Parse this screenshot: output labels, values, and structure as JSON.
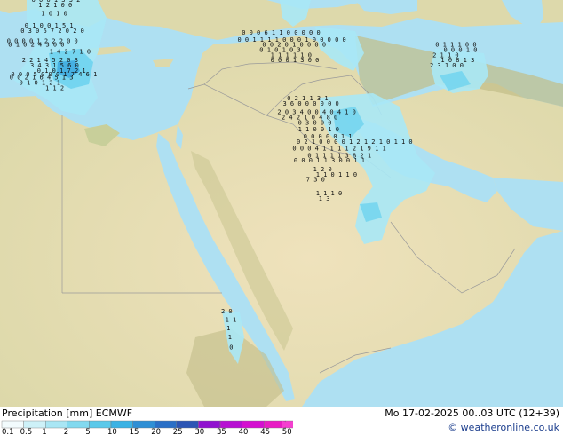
{
  "footer": {
    "title": "Precipitation [mm]  ECMWF",
    "valid": "Mo 17-02-2025 00..03 UTC (12+39)",
    "credit": "© weatheronline.co.uk"
  },
  "legend": {
    "labels": [
      "0.1",
      "0.5",
      "1",
      "2",
      "5",
      "10",
      "15",
      "20",
      "25",
      "30",
      "35",
      "40",
      "45",
      "50"
    ],
    "colors": [
      "#f2fbfd",
      "#cdf1f8",
      "#a9e6f4",
      "#82d9ef",
      "#5bc9ea",
      "#3bb2e4",
      "#2f8fd5",
      "#2a6fc6",
      "#2c55b4",
      "#9013cf",
      "#b70fd2",
      "#d40fd0",
      "#e81cc4",
      "#f53fd0"
    ]
  },
  "colors": {
    "sea": "#aee0f2",
    "land": "#e0dbae",
    "desert": "#eddfb8",
    "mountain": "#bfba86",
    "rain_light": "#a8e8f6",
    "rain_medium": "#6ed3ef",
    "rain_heavy": "#3ba6de"
  },
  "precip_values": [
    {
      "row": "0 0 0 1 3 3 2",
      "lat": 35.9,
      "lon": 22.3
    },
    {
      "row": "1 2 1 0 0",
      "lat": 35.6,
      "lon": 22.8
    },
    {
      "row": "1 0 1 0",
      "lat": 35.1,
      "lon": 23.0
    },
    {
      "row": "0 1 0 0 1 5 1",
      "lat": 34.4,
      "lon": 21.8
    },
    {
      "row": "0 3  0 6 7 2 0 2 0",
      "lat": 34.1,
      "lon": 21.5
    },
    {
      "row": "0 0 0 0    1 2 2 2 0 0",
      "lat": 33.5,
      "lon": 20.5
    },
    {
      "row": "0 1     0 2 4 3 0 0",
      "lat": 33.3,
      "lon": 20.6
    },
    {
      "row": "1 4 2 7 1 0",
      "lat": 32.9,
      "lon": 23.6
    },
    {
      "row": "2 2 1 4 5 2 0 3",
      "lat": 32.4,
      "lon": 21.6
    },
    {
      "row": "3 4 3 1 5 6 0",
      "lat": 32.1,
      "lon": 22.2
    },
    {
      "row": "0 1 0 1 7 2 1",
      "lat": 31.8,
      "lon": 22.7
    },
    {
      "row": "0 0 0 5 0 0 0 1 7 4 6 1",
      "lat": 31.6,
      "lon": 20.8
    },
    {
      "row": "0 0 2 1 6 4 5 1 3",
      "lat": 31.4,
      "lon": 20.7
    },
    {
      "row": "0 1 0 1 2 1",
      "lat": 31.1,
      "lon": 21.4
    },
    {
      "row": "1 1 2",
      "lat": 30.8,
      "lon": 23.3
    },
    {
      "row": "0 0 0 6 1 1 0 0 0 0 0",
      "lat": 34.0,
      "lon": 37.6
    },
    {
      "row": "0 0 1 1 1 1 0 0 0 1 0 0 0 0 0",
      "lat": 33.6,
      "lon": 37.3
    },
    {
      "row": "0 0 2 0 1 0 0 0 0",
      "lat": 33.3,
      "lon": 39.1
    },
    {
      "row": "0 1 0 1   0 3",
      "lat": 33.0,
      "lon": 38.9
    },
    {
      "row": "1 1 1 1 1 0",
      "lat": 32.7,
      "lon": 39.7
    },
    {
      "row": "0 0 0 1 3 0 0",
      "lat": 32.4,
      "lon": 39.7
    },
    {
      "row": "0 1 1 1 0 0",
      "lat": 33.3,
      "lon": 51.7
    },
    {
      "row": "0 0 0 1 0",
      "lat": 33.0,
      "lon": 52.3
    },
    {
      "row": "2 1 1 0",
      "lat": 32.7,
      "lon": 51.5
    },
    {
      "row": "1 0 8 1 3",
      "lat": 32.4,
      "lon": 52.1
    },
    {
      "row": "2 3 1 0 0",
      "lat": 32.1,
      "lon": 51.3
    },
    {
      "row": "0 2 1 1 3 1",
      "lat": 30.2,
      "lon": 40.9
    },
    {
      "row": "3 6 0   0 0 0 0 0",
      "lat": 29.9,
      "lon": 40.6
    },
    {
      "row": "2 0 3 4   0   0 4 0 4 1 0",
      "lat": 29.4,
      "lon": 40.2
    },
    {
      "row": "2 4 2 1   0   4 8 0",
      "lat": 29.1,
      "lon": 40.5
    },
    {
      "row": "0 3 0 0   0",
      "lat": 28.8,
      "lon": 41.7
    },
    {
      "row": "1 1 0     0 1 0",
      "lat": 28.4,
      "lon": 41.7
    },
    {
      "row": "0 0 0     0 0 1 1",
      "lat": 28.0,
      "lon": 42.1
    },
    {
      "row": "0 2 1 0 0 0 0 1 2 1 2 1 0 1 1 0",
      "lat": 27.7,
      "lon": 41.6
    },
    {
      "row": "0 0   0 4 1 1 1 1 2 1 9 1 1",
      "lat": 27.3,
      "lon": 41.3
    },
    {
      "row": "0 1   1 1 1 3 8 2 1",
      "lat": 26.9,
      "lon": 42.4
    },
    {
      "row": "0 0 0 1 1 3 0   0 1 1",
      "lat": 26.6,
      "lon": 41.4
    },
    {
      "row": "1 2 0",
      "lat": 26.1,
      "lon": 42.8
    },
    {
      "row": "1 1 0 1 1 0",
      "lat": 25.8,
      "lon": 43.0
    },
    {
      "row": "7 3 0",
      "lat": 25.5,
      "lon": 42.3
    },
    {
      "row": "1 1 1 0",
      "lat": 24.7,
      "lon": 43.0
    },
    {
      "row": "1 3",
      "lat": 24.4,
      "lon": 43.2
    },
    {
      "row": "2 0",
      "lat": 17.9,
      "lon": 36.1
    },
    {
      "row": "1 1",
      "lat": 17.4,
      "lon": 36.4
    },
    {
      "row": "1",
      "lat": 16.9,
      "lon": 36.5
    },
    {
      "row": "1",
      "lat": 16.4,
      "lon": 36.6
    },
    {
      "row": "0",
      "lat": 15.8,
      "lon": 36.7
    }
  ]
}
